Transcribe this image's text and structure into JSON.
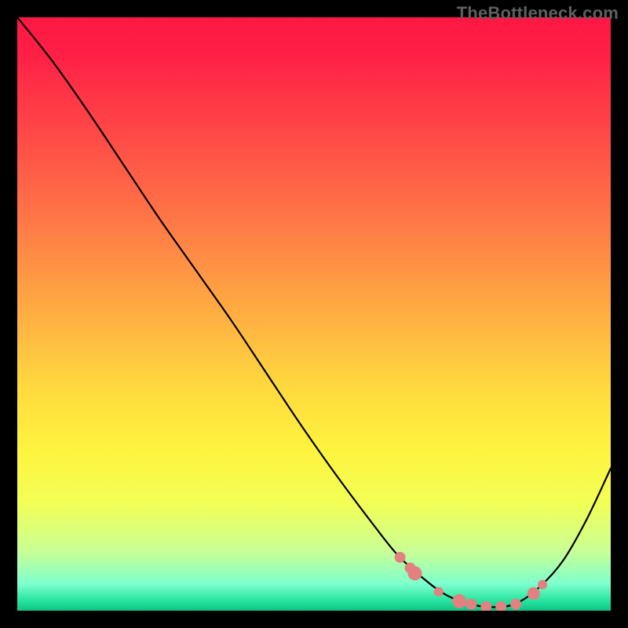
{
  "watermark": "TheBottleneck.com",
  "chart_data": {
    "type": "line",
    "title": "",
    "xlabel": "",
    "ylabel": "",
    "xlim": [
      0,
      1
    ],
    "ylim": [
      0,
      1
    ],
    "grid": false,
    "gradient_stops": [
      {
        "offset": 0.0,
        "color": "#ff1744"
      },
      {
        "offset": 0.06,
        "color": "#ff1f45"
      },
      {
        "offset": 0.2,
        "color": "#ff4a47"
      },
      {
        "offset": 0.35,
        "color": "#ff7a46"
      },
      {
        "offset": 0.5,
        "color": "#ffae42"
      },
      {
        "offset": 0.62,
        "color": "#ffd83e"
      },
      {
        "offset": 0.73,
        "color": "#fef43e"
      },
      {
        "offset": 0.82,
        "color": "#f2ff56"
      },
      {
        "offset": 0.9,
        "color": "#c9ff95"
      },
      {
        "offset": 0.955,
        "color": "#7dffce"
      },
      {
        "offset": 0.985,
        "color": "#22e29b"
      },
      {
        "offset": 1.0,
        "color": "#11c082"
      }
    ],
    "series": [
      {
        "name": "bottleneck-curve",
        "x": [
          0.0,
          0.06,
          0.12,
          0.18,
          0.24,
          0.3,
          0.36,
          0.42,
          0.48,
          0.54,
          0.6,
          0.64,
          0.68,
          0.72,
          0.76,
          0.8,
          0.84,
          0.88,
          0.92,
          0.96,
          1.0
        ],
        "y": [
          1.0,
          0.925,
          0.84,
          0.75,
          0.66,
          0.575,
          0.49,
          0.4,
          0.31,
          0.225,
          0.145,
          0.095,
          0.058,
          0.028,
          0.012,
          0.006,
          0.012,
          0.04,
          0.085,
          0.155,
          0.24
        ]
      }
    ],
    "markers": [
      {
        "x": 0.645,
        "y": 0.09,
        "r": 7
      },
      {
        "x": 0.662,
        "y": 0.072,
        "r": 7
      },
      {
        "x": 0.67,
        "y": 0.063,
        "r": 9
      },
      {
        "x": 0.71,
        "y": 0.032,
        "r": 6
      },
      {
        "x": 0.745,
        "y": 0.016,
        "r": 9
      },
      {
        "x": 0.765,
        "y": 0.011,
        "r": 7
      },
      {
        "x": 0.79,
        "y": 0.007,
        "r": 7
      },
      {
        "x": 0.815,
        "y": 0.007,
        "r": 7
      },
      {
        "x": 0.84,
        "y": 0.011,
        "r": 7
      },
      {
        "x": 0.87,
        "y": 0.029,
        "r": 8
      },
      {
        "x": 0.885,
        "y": 0.044,
        "r": 6
      }
    ],
    "marker_color": "#e38080"
  }
}
